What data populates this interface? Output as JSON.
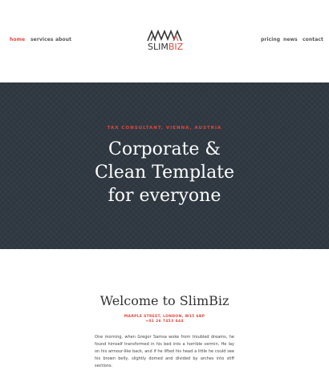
{
  "nav": {
    "left": [
      {
        "label": "home",
        "active": true
      },
      {
        "label": "services"
      },
      {
        "label": "about"
      }
    ],
    "right": [
      {
        "label": "pricing"
      },
      {
        "label": "news"
      },
      {
        "label": "contact"
      }
    ]
  },
  "logo": {
    "slim": "SLIM",
    "biz": "BIZ"
  },
  "hero": {
    "eyebrow": "TAX CONSULTANT, VIENNA, AUSTRIA",
    "title_line1": "Corporate &",
    "title_line2": "Clean Template",
    "title_line3": "for everyone"
  },
  "welcome": {
    "title": "Welcome to SlimBiz",
    "address": "MARPLE STREET, LONDON, W15 6BP",
    "phone": "+01 26 7453 444",
    "intro": "One morning, when Gregor Samsa woke from troubled dreams, he found himself transformed in his bed into a horrible vermin. He lay on his armour-like back, and if he lifted his head a little he could see his brown belly, slightly domed and divided by arches into stiff sections."
  },
  "colors": {
    "accent": "#e0473c",
    "hero_bg": "#2e3740",
    "text": "#333333"
  }
}
